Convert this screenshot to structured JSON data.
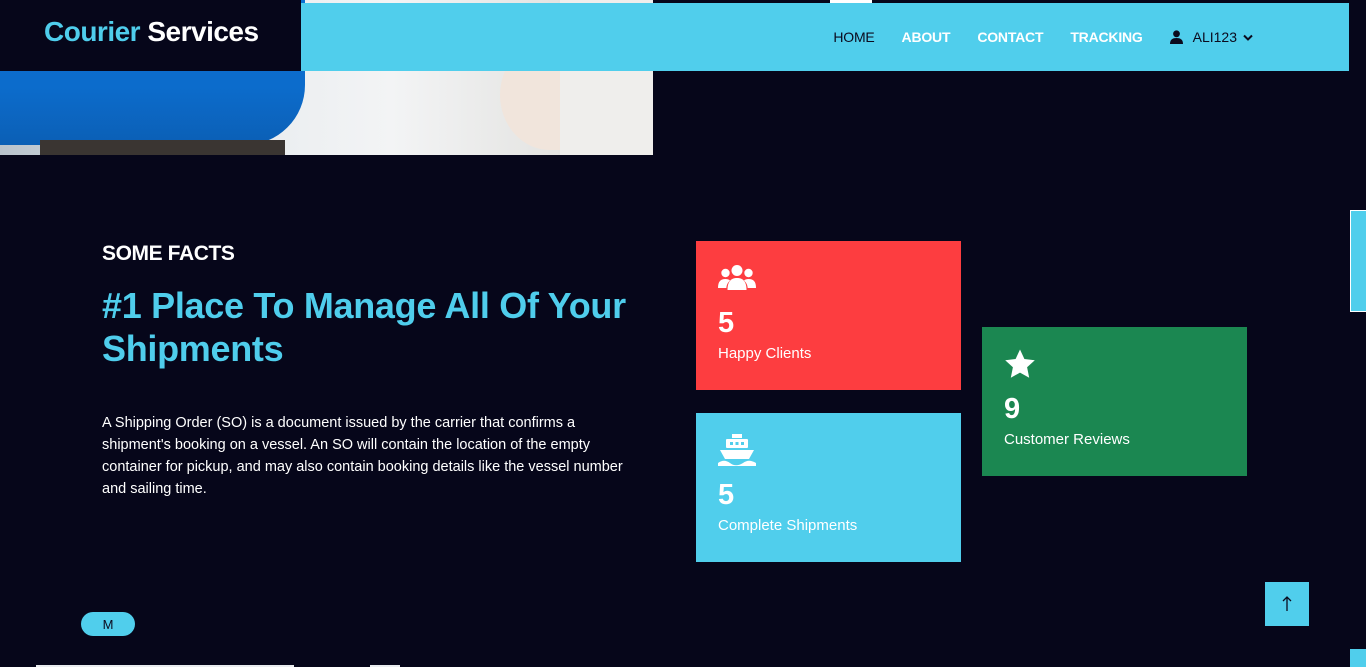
{
  "brand": {
    "part1": "Courier",
    "part2": " Services"
  },
  "nav": {
    "items": [
      {
        "label": "HOME",
        "active": true
      },
      {
        "label": "ABOUT",
        "active": false
      },
      {
        "label": "CONTACT",
        "active": false
      },
      {
        "label": "TRACKING",
        "active": false
      }
    ],
    "user": {
      "name": "ALI123",
      "icon": "user-icon",
      "caret": "chevron-down-icon"
    }
  },
  "facts": {
    "eyebrow": "SOME FACTS",
    "heading": "#1 Place To Manage All Of Your Shipments",
    "body": "A Shipping Order (SO) is a document issued by the carrier that confirms a shipment's booking on a vessel. An SO will contain the location of the empty container for pickup, and may also contain booking details like the vessel number and sailing time."
  },
  "stats": [
    {
      "icon": "users-icon",
      "value": "5",
      "label": "Happy Clients",
      "color": "#fd3d40"
    },
    {
      "icon": "ship-icon",
      "value": "5",
      "label": "Complete Shipments",
      "color": "#50ceec"
    },
    {
      "icon": "star-icon",
      "value": "9",
      "label": "Customer Reviews",
      "color": "#1b8751"
    }
  ],
  "floating": {
    "pill_label": "M",
    "back_to_top_icon": "arrow-up-icon"
  },
  "colors": {
    "accent": "#50ceec",
    "background": "#06061a"
  }
}
